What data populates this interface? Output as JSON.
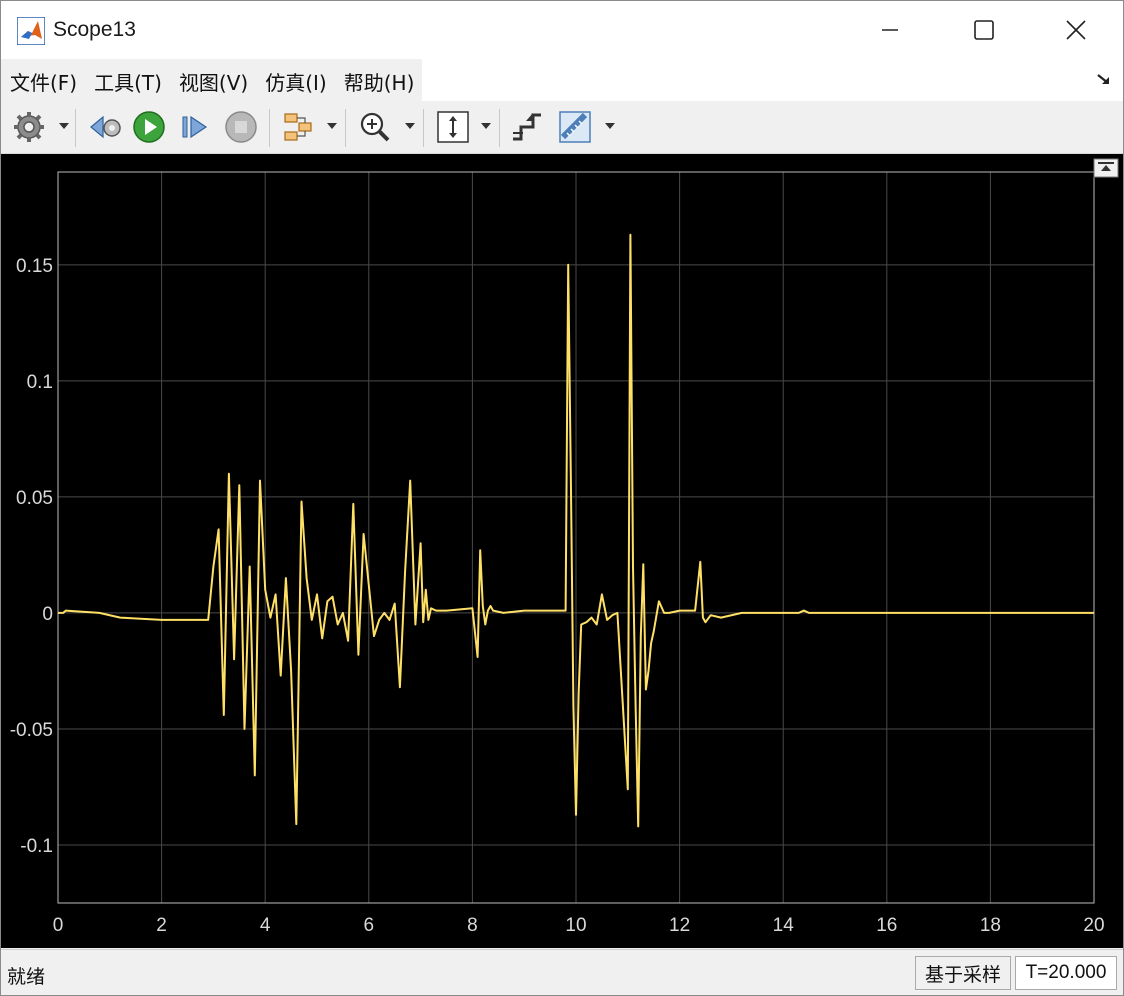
{
  "window": {
    "title": "Scope13"
  },
  "menu": {
    "items": [
      "文件(F)",
      "工具(T)",
      "视图(V)",
      "仿真(I)",
      "帮助(H)"
    ]
  },
  "toolbar": {
    "icons": [
      "settings-icon",
      "step-back-icon",
      "run-icon",
      "step-forward-icon",
      "stop-icon",
      "highlight-block-icon",
      "zoom-in-icon",
      "scale-axes-icon",
      "triggers-icon",
      "measurements-icon"
    ]
  },
  "status": {
    "text": "就绪",
    "mode": "基于采样",
    "time": "T=20.000"
  },
  "colors": {
    "plot_bg": "#000000",
    "line": "#FFE066",
    "grid": "#4a4a4a",
    "tick_label": "#d9d9d9"
  },
  "chart_data": {
    "type": "line",
    "title": "",
    "xlabel": "",
    "ylabel": "",
    "xlim": [
      0,
      20
    ],
    "ylim": [
      -0.125,
      0.19
    ],
    "xticks": [
      0,
      2,
      4,
      6,
      8,
      10,
      12,
      14,
      16,
      18,
      20
    ],
    "yticks": [
      -0.1,
      -0.05,
      0,
      0.05,
      0.1,
      0.15
    ],
    "ytick_labels": [
      "-0.1",
      "-0.05",
      "0",
      "0.05",
      "0.1",
      "0.15"
    ],
    "grid": true,
    "series": [
      {
        "color": "#FFE066",
        "x": [
          0,
          0.1,
          0.15,
          0.8,
          1.2,
          2.0,
          2.9,
          3.0,
          3.1,
          3.2,
          3.3,
          3.4,
          3.5,
          3.6,
          3.7,
          3.8,
          3.9,
          4.0,
          4.1,
          4.2,
          4.3,
          4.4,
          4.5,
          4.6,
          4.7,
          4.8,
          4.9,
          5.0,
          5.1,
          5.2,
          5.3,
          5.4,
          5.5,
          5.6,
          5.7,
          5.8,
          5.9,
          6.0,
          6.1,
          6.2,
          6.3,
          6.4,
          6.5,
          6.6,
          6.7,
          6.8,
          6.9,
          7.0,
          7.05,
          7.1,
          7.15,
          7.2,
          7.3,
          7.5,
          8.0,
          8.1,
          8.15,
          8.2,
          8.25,
          8.3,
          8.35,
          8.4,
          8.6,
          9.0,
          9.8,
          9.85,
          9.9,
          9.95,
          10.0,
          10.05,
          10.1,
          10.2,
          10.3,
          10.4,
          10.5,
          10.6,
          10.7,
          10.8,
          11.0,
          11.05,
          11.1,
          11.15,
          11.2,
          11.25,
          11.3,
          11.35,
          11.4,
          11.45,
          11.5,
          11.6,
          11.7,
          11.8,
          12.0,
          12.3,
          12.4,
          12.45,
          12.5,
          12.6,
          12.8,
          13.2,
          14.3,
          14.4,
          14.5,
          20
        ],
        "y": [
          0,
          0,
          0.001,
          0,
          -0.002,
          -0.003,
          -0.003,
          0.02,
          0.036,
          -0.044,
          0.06,
          -0.02,
          0.055,
          -0.05,
          0.02,
          -0.07,
          0.057,
          0.01,
          -0.002,
          0.008,
          -0.027,
          0.015,
          -0.025,
          -0.091,
          0.048,
          0.015,
          -0.003,
          0.008,
          -0.011,
          0.005,
          0.007,
          -0.005,
          0,
          -0.012,
          0.047,
          -0.018,
          0.034,
          0.012,
          -0.01,
          -0.003,
          0,
          -0.003,
          0.004,
          -0.032,
          0.018,
          0.057,
          -0.005,
          0.03,
          -0.004,
          0.01,
          -0.003,
          0.002,
          0.001,
          0.001,
          0.002,
          -0.019,
          0.027,
          0.003,
          -0.005,
          0.001,
          0.003,
          0.001,
          0,
          0.001,
          0.001,
          0.15,
          0.06,
          -0.04,
          -0.087,
          -0.035,
          -0.005,
          -0.004,
          -0.002,
          -0.005,
          0.008,
          -0.003,
          -0.001,
          0,
          -0.076,
          0.163,
          0.02,
          -0.04,
          -0.092,
          -0.01,
          0.021,
          -0.033,
          -0.025,
          -0.013,
          -0.008,
          0.005,
          0,
          0,
          0.001,
          0.001,
          0.022,
          -0.002,
          -0.004,
          -0.001,
          -0.002,
          0,
          0,
          0.001,
          0,
          0
        ]
      }
    ]
  }
}
